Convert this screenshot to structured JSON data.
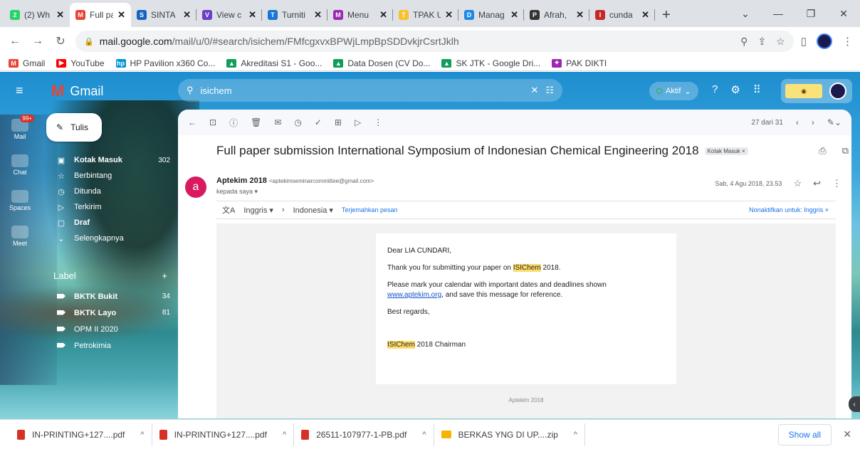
{
  "browser": {
    "tabs": [
      {
        "label": "(2) Wh",
        "icon": "whatsapp-icon",
        "color": "#25d366",
        "glyph": "2"
      },
      {
        "label": "Full pa",
        "icon": "gmail-icon",
        "color": "#ea4335",
        "glyph": "M"
      },
      {
        "label": "SINTA",
        "icon": "sinta-icon",
        "color": "#1565c0",
        "glyph": "S"
      },
      {
        "label": "View c",
        "icon": "view-icon",
        "color": "#6a3fc6",
        "glyph": "V"
      },
      {
        "label": "Turniti",
        "icon": "turnitin-icon",
        "color": "#1976d2",
        "glyph": "T"
      },
      {
        "label": "Menu",
        "icon": "menu-icon",
        "color": "#9c27b0",
        "glyph": "M"
      },
      {
        "label": "TPAK U",
        "icon": "tpak-icon",
        "color": "#fbc02d",
        "glyph": "T"
      },
      {
        "label": "Manag",
        "icon": "doc-icon",
        "color": "#1e88e5",
        "glyph": "D"
      },
      {
        "label": "Afrah,",
        "icon": "pkp-icon",
        "color": "#333333",
        "glyph": "P"
      },
      {
        "label": "cunda",
        "icon": "iop-icon",
        "color": "#c62828",
        "glyph": "I"
      }
    ],
    "new_tab": "+",
    "url_host": "mail.google.com",
    "url_path": "/mail/u/0/#search/isichem/FMfcgxvxBPWjLmpBpSDDvkjrCsrtJklh",
    "bookmarks": [
      {
        "label": "Gmail",
        "color": "#ea4335",
        "glyph": "M"
      },
      {
        "label": "YouTube",
        "color": "#ff0000",
        "glyph": "▶"
      },
      {
        "label": "HP Pavilion x360 Co...",
        "color": "#0096d6",
        "glyph": "hp"
      },
      {
        "label": "Akreditasi S1 - Goo...",
        "color": "#0f9d58",
        "glyph": "▲"
      },
      {
        "label": "Data Dosen (CV Do...",
        "color": "#0f9d58",
        "glyph": "▲"
      },
      {
        "label": "SK JTK - Google Dri...",
        "color": "#0f9d58",
        "glyph": "▲"
      },
      {
        "label": "PAK DIKTI",
        "color": "#9c27b0",
        "glyph": "✦"
      }
    ]
  },
  "gmail": {
    "app_name": "Gmail",
    "search_query": "isichem",
    "status": "Aktif",
    "rail": [
      {
        "label": "Mail",
        "badge": "99+"
      },
      {
        "label": "Chat",
        "badge": ""
      },
      {
        "label": "Spaces",
        "badge": ""
      },
      {
        "label": "Meet",
        "badge": ""
      }
    ],
    "compose_label": "Tulis",
    "nav": [
      {
        "label": "Kotak Masuk",
        "count": "302",
        "icon": "inbox-icon",
        "glyph": "▣",
        "bold": true
      },
      {
        "label": "Berbintang",
        "count": "",
        "icon": "star-icon",
        "glyph": "☆",
        "bold": false
      },
      {
        "label": "Ditunda",
        "count": "",
        "icon": "clock-icon",
        "glyph": "◷",
        "bold": false
      },
      {
        "label": "Terkirim",
        "count": "",
        "icon": "send-icon",
        "glyph": "▷",
        "bold": false
      },
      {
        "label": "Draf",
        "count": "",
        "icon": "draft-icon",
        "glyph": "▢",
        "bold": true
      },
      {
        "label": "Selengkapnya",
        "count": "",
        "icon": "expand-icon",
        "glyph": "⌄",
        "bold": false
      }
    ],
    "labels_heading": "Label",
    "labels_add": "+",
    "labels": [
      {
        "label": "BKTK Bukit",
        "count": "34",
        "bold": true
      },
      {
        "label": "BKTK Layo",
        "count": "81",
        "bold": true
      },
      {
        "label": "OPM II 2020",
        "count": "",
        "bold": false
      },
      {
        "label": "Petrokimia",
        "count": "",
        "bold": false
      }
    ],
    "pagination": "27 dari 31",
    "subject": "Full paper submission International Symposium of Indonesian Chemical Engineering 2018",
    "subject_tag": "Kotak Masuk ×",
    "sender_initial": "a",
    "sender_name": "Aptekim 2018",
    "sender_email": "<aptekimseminarcommittee@gmail.com>",
    "recipient": "kepada saya ▾",
    "date": "Sab, 4 Agu 2018, 23.53",
    "translate": {
      "from": "Inggris",
      "to": "Indonesia",
      "link": "Terjemahkan pesan",
      "disable": "Nonaktifkan untuk: Inggris"
    },
    "body": {
      "greeting": "Dear LIA CUNDARI,",
      "line1_pre": "Thank you for submitting your paper on ",
      "highlight": "ISIChem",
      "line1_post": " 2018.",
      "line2": "Please mark your calendar with important dates and deadlines shown",
      "link": "www.aptekim.org",
      "line3_post": ", and save this message for reference.",
      "regards": "Best regards,",
      "sign_post": " 2018 Chairman",
      "footer": "Aptekim 2018"
    }
  },
  "downloads": [
    {
      "name": "IN-PRINTING+127....pdf",
      "type": "pdf"
    },
    {
      "name": "IN-PRINTING+127....pdf",
      "type": "pdf"
    },
    {
      "name": "26511-107977-1-PB.pdf",
      "type": "pdf"
    },
    {
      "name": "BERKAS YNG DI UP....zip",
      "type": "zip"
    }
  ],
  "show_all": "Show all"
}
